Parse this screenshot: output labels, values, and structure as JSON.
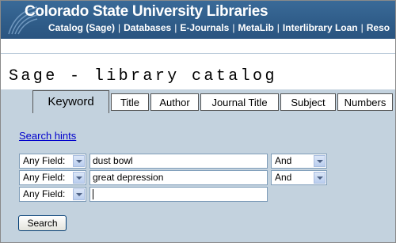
{
  "header": {
    "title": "Colorado State University Libraries",
    "nav": [
      "Catalog (Sage)",
      "Databases",
      "E-Journals",
      "MetaLib",
      "Interlibrary Loan",
      "Reso"
    ]
  },
  "page_title": "Sage - library catalog",
  "tabs": [
    "Keyword",
    "Title",
    "Author",
    "Journal Title",
    "Subject",
    "Numbers"
  ],
  "active_tab": "Keyword",
  "search_hints": "Search hints",
  "rows": [
    {
      "field": "Any Field:",
      "value": "dust bowl",
      "operator": "And"
    },
    {
      "field": "Any Field:",
      "value": "great depression",
      "operator": "And"
    },
    {
      "field": "Any Field:",
      "value": ""
    }
  ],
  "search_button": "Search",
  "colors": {
    "header_bg": "#2f5c88",
    "panel_bg": "#c3d2de",
    "link": "#0000cc"
  }
}
